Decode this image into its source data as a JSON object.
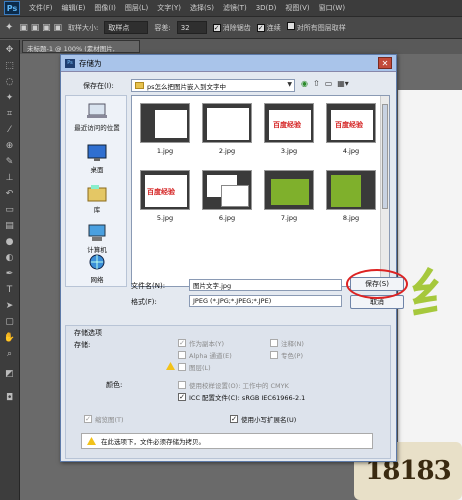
{
  "app": {
    "logo": "Ps",
    "menu": [
      "文件(F)",
      "编辑(E)",
      "图像(I)",
      "图层(L)",
      "文字(Y)",
      "选择(S)",
      "滤镜(T)",
      "3D(D)",
      "视图(V)",
      "窗口(W)"
    ]
  },
  "options_bar": {
    "sample_size_label": "取样大小:",
    "sample_size_value": "取样点",
    "tolerance_label": "容差:",
    "tolerance_value": "32",
    "antialias": "消除锯齿",
    "contiguous": "连续",
    "sample_all_layers": "对所有图层取样"
  },
  "document_tab": "未标题-1 @ 100% (素材图片, RGB/8) *",
  "dialog": {
    "title": "存储为",
    "save_in_label": "保存在(I):",
    "save_in_value": "ps怎么把图片嵌入到文字中",
    "sidebar": [
      {
        "label": "最近访问的位置",
        "icon": "recent-places-icon"
      },
      {
        "label": "桌面",
        "icon": "desktop-icon"
      },
      {
        "label": "库",
        "icon": "library-icon"
      },
      {
        "label": "计算机",
        "icon": "computer-icon"
      },
      {
        "label": "网络",
        "icon": "network-icon"
      }
    ],
    "files": [
      "1.jpg",
      "2.jpg",
      "3.jpg",
      "4.jpg",
      "5.jpg",
      "6.jpg",
      "7.jpg",
      "8.jpg"
    ],
    "thumb_text": "百度经验",
    "thumb_text_cut": "百度经",
    "file_name_label": "文件名(N):",
    "file_name_value": "图片文字.jpg",
    "format_label": "格式(F):",
    "format_value": "JPEG (*.JPG;*.JPEG;*.JPE)",
    "save_button": "保存(S)",
    "cancel_button": "取消",
    "options_title": "存储选项",
    "storage_label": "存储:",
    "opt_as_copy": "作为副本(Y)",
    "opt_alpha": "Alpha 通道(E)",
    "opt_layers": "图层(L)",
    "opt_notes": "注释(N)",
    "opt_spot": "专色(P)",
    "color_label": "颜色:",
    "opt_proof": "使用校样设置(O): 工作中的 CMYK",
    "opt_icc": "ICC 配置文件(C): sRGB IEC61966-2.1",
    "opt_thumbnail": "缩览图(T)",
    "opt_lowercase": "使用小写扩展名(U)",
    "warning_text": "在此选项下，文件必须存储为拷贝。"
  },
  "colors": {
    "save_highlight": "#dd2222",
    "dialog_title": "#a9c4ea"
  }
}
